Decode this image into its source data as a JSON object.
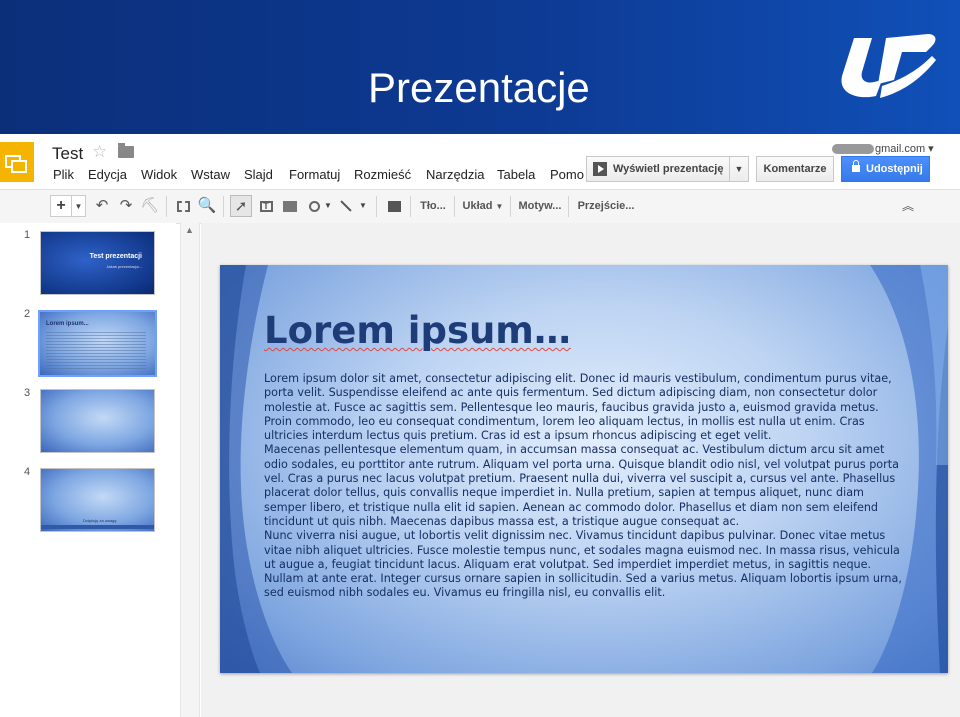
{
  "banner": {
    "title": "Prezentacje"
  },
  "app": {
    "doc_title": "Test",
    "account_email": "gmail.com",
    "menu": [
      "Plik",
      "Edycja",
      "Widok",
      "Wstaw",
      "Slajd",
      "Formatuj",
      "Rozmieść",
      "Narzędzia",
      "Tabela",
      "Pomo"
    ],
    "buttons": {
      "present": "Wyświetl prezentację",
      "comments": "Komentarze",
      "share": "Udostępnij"
    },
    "toolbar": {
      "plus": "+",
      "background": "Tło...",
      "layout": "Układ",
      "theme": "Motyw...",
      "transition": "Przejście..."
    },
    "accent_colors": {
      "share_button": "#4d90fe",
      "app_logo": "#f4b400",
      "banner": "#0d3a93",
      "slide_title": "#1d3c78"
    }
  },
  "filmstrip": {
    "slides": [
      {
        "number": "1",
        "title": "Test prezentacji",
        "subtitle": "Jakaś prezentacja..."
      },
      {
        "number": "2",
        "title": "Lorem ipsum..."
      },
      {
        "number": "3"
      },
      {
        "number": "4",
        "footer": "Dziękuję za uwagę"
      }
    ]
  },
  "slide": {
    "title": "Lorem ipsum…",
    "paragraphs": [
      "Lorem ipsum dolor sit amet, consectetur adipiscing elit. Donec id mauris vestibulum, condimentum purus vitae, porta velit. Suspendisse eleifend ac ante quis fermentum. Sed dictum adipiscing diam, non consectetur dolor molestie at. Fusce ac sagittis sem. Pellentesque leo mauris, faucibus gravida justo a, euismod gravida metus. Proin commodo, leo eu consequat condimentum, lorem leo aliquam lectus, in mollis est nulla ut enim. Cras ultricies interdum lectus quis pretium. Cras id est a ipsum rhoncus adipiscing et eget velit.",
      "Maecenas pellentesque elementum quam, in accumsan massa consequat ac. Vestibulum dictum arcu sit amet odio sodales, eu porttitor ante rutrum. Aliquam vel porta urna. Quisque blandit odio nisl, vel volutpat purus porta vel. Cras a purus nec lacus volutpat pretium. Praesent nulla dui, viverra vel suscipit a, cursus vel ante. Phasellus placerat dolor tellus, quis convallis neque imperdiet in. Nulla pretium, sapien at tempus aliquet, nunc diam semper libero, et tristique nulla elit id sapien. Aenean ac commodo dolor. Phasellus et diam non sem eleifend tincidunt ut quis nibh. Maecenas dapibus massa est, a tristique augue consequat ac.",
      "Nunc viverra nisi augue, ut lobortis velit dignissim nec. Vivamus tincidunt dapibus pulvinar. Donec vitae metus vitae nibh aliquet ultricies. Fusce molestie tempus nunc, et sodales magna euismod nec. In massa risus, vehicula ut augue a, feugiat tincidunt lacus. Aliquam erat volutpat. Sed imperdiet imperdiet metus, in sagittis neque. Nullam at ante erat. Integer cursus ornare sapien in sollicitudin. Sed a varius metus. Aliquam lobortis ipsum urna, sed euismod nibh sodales eu. Vivamus eu fringilla nisl, eu convallis elit."
    ]
  }
}
